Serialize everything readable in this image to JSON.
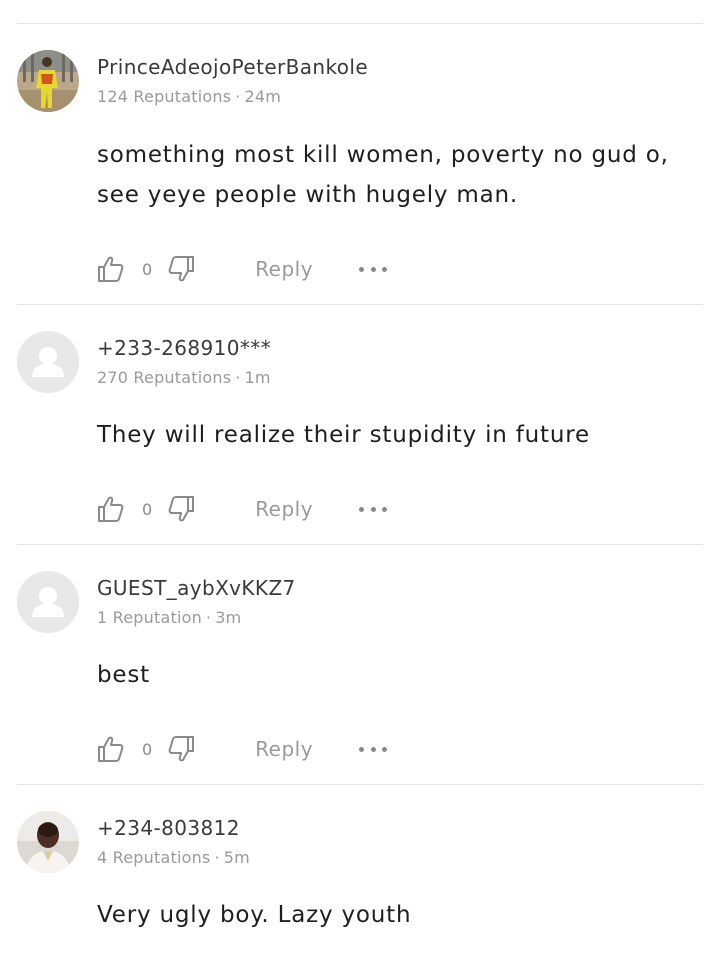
{
  "comments": [
    {
      "username": "PrinceAdeojoPeterBankole",
      "reputation": "124 Reputations",
      "separator": "·",
      "time": "24m",
      "text": "something most kill women, poverty no gud o, see yeye people with hugely man.",
      "likes": "0",
      "reply_label": "Reply",
      "avatar": "user-photo"
    },
    {
      "username": "+233-268910***",
      "reputation": "270 Reputations",
      "separator": "·",
      "time": "1m",
      "text": "They will realize their stupidity in future",
      "likes": "0",
      "reply_label": "Reply",
      "avatar": "default-avatar"
    },
    {
      "username": "GUEST_aybXvKKZ7",
      "reputation": "1 Reputation",
      "separator": "·",
      "time": "3m",
      "text": "best",
      "likes": "0",
      "reply_label": "Reply",
      "avatar": "default-avatar"
    },
    {
      "username": "+234-803812",
      "reputation": "4 Reputations",
      "separator": "·",
      "time": "5m",
      "text": "Very ugly boy. Lazy youth",
      "avatar": "user-photo"
    }
  ],
  "icons": {
    "like": "thumbs-up-icon",
    "dislike": "thumbs-down-icon",
    "more": "more-options-icon"
  },
  "colors": {
    "text": "#1e1e1e",
    "muted": "#9a9a9a",
    "divider": "#e6e6e6"
  }
}
